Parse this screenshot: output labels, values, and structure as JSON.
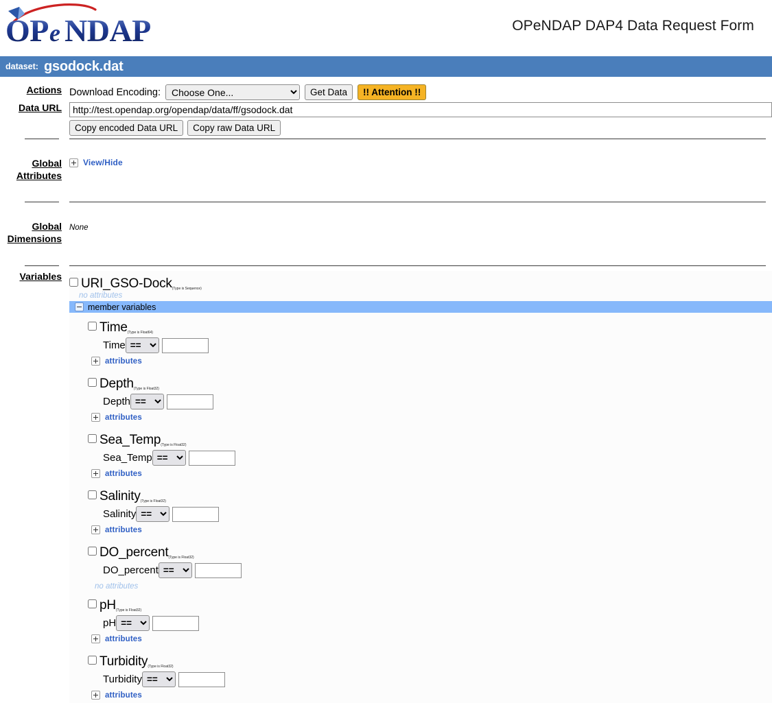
{
  "header": {
    "title": "OPeNDAP DAP4 Data Request Form",
    "logo_text": "OPeNDAP",
    "logo_alt": "opendap-logo"
  },
  "dataset_bar": {
    "label": "dataset:",
    "name": "gsodock.dat"
  },
  "sections": {
    "actions": {
      "label": "Actions",
      "encoding_label": "Download Encoding:",
      "encoding_value": "Choose One...",
      "get_data_label": "Get Data",
      "attention_label": "!! Attention !!"
    },
    "data_url": {
      "label": "Data URL",
      "url_value": "http://test.opendap.org/opendap/data/ff/gsodock.dat",
      "copy_encoded_label": "Copy encoded Data URL",
      "copy_raw_label": "Copy raw Data URL"
    },
    "global_attributes": {
      "label_line1": "Global",
      "label_line2": "Attributes",
      "toggle_label": "View/Hide"
    },
    "global_dimensions": {
      "label_line1": "Global",
      "label_line2": "Dimensions",
      "value": "None"
    },
    "variables": {
      "label": "Variables"
    }
  },
  "sequence": {
    "name": "URI_GSO-Dock",
    "type_note": "(Type is Sequence)",
    "attributes_text": "no attributes",
    "member_variables_label": "member variables",
    "checked": false
  },
  "variables": [
    {
      "name": "Time",
      "type_note": "(Type is Float64)",
      "operator": "==",
      "value": "",
      "attributes_label": "attributes",
      "has_attributes": true,
      "no_attributes_text": "",
      "checked": false
    },
    {
      "name": "Depth",
      "type_note": "(Type is Float32)",
      "operator": "==",
      "value": "",
      "attributes_label": "attributes",
      "has_attributes": true,
      "no_attributes_text": "",
      "checked": false
    },
    {
      "name": "Sea_Temp",
      "type_note": "(Type is Float32)",
      "operator": "==",
      "value": "",
      "attributes_label": "attributes",
      "has_attributes": true,
      "no_attributes_text": "",
      "checked": false
    },
    {
      "name": "Salinity",
      "type_note": "(Type is Float32)",
      "operator": "==",
      "value": "",
      "attributes_label": "attributes",
      "has_attributes": true,
      "no_attributes_text": "",
      "checked": false
    },
    {
      "name": "DO_percent",
      "type_note": "(Type is Float32)",
      "operator": "==",
      "value": "",
      "attributes_label": "",
      "has_attributes": false,
      "no_attributes_text": "no attributes",
      "checked": false
    },
    {
      "name": "pH",
      "type_note": "(Type is Float32)",
      "operator": "==",
      "value": "",
      "attributes_label": "attributes",
      "has_attributes": true,
      "no_attributes_text": "",
      "checked": false
    },
    {
      "name": "Turbidity",
      "type_note": "(Type is Float32)",
      "operator": "==",
      "value": "",
      "attributes_label": "attributes",
      "has_attributes": true,
      "no_attributes_text": "",
      "checked": false
    }
  ],
  "colors": {
    "dataset_bar": "#4a7ebb",
    "member_bar": "#86b8fb",
    "attention": "#f5b324",
    "link": "#2f5fc4",
    "logo_blue": "#1f3a93",
    "logo_red": "#cc2222"
  }
}
